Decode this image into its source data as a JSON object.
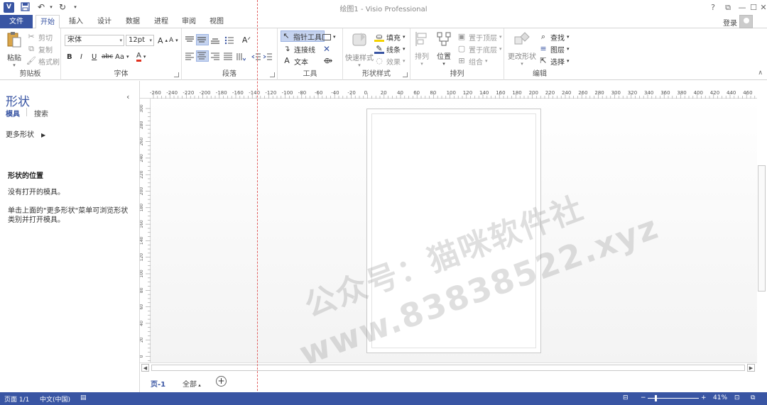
{
  "window": {
    "title": "绘图1 - Visio Professional",
    "app_logo": "V",
    "controls": [
      "?",
      "⧉",
      "—",
      "☐",
      "✕"
    ]
  },
  "qat": {
    "save_icon": "save-icon",
    "undo_icon": "undo-icon",
    "redo_icon": "redo-icon",
    "customize_icon": "customize-icon"
  },
  "tabs": [
    {
      "label": "文件"
    },
    {
      "label": "开始"
    },
    {
      "label": "插入"
    },
    {
      "label": "设计"
    },
    {
      "label": "数据"
    },
    {
      "label": "进程"
    },
    {
      "label": "审阅"
    },
    {
      "label": "视图"
    }
  ],
  "account": {
    "login": "登录"
  },
  "ribbon": {
    "clipboard": {
      "label": "剪贴板",
      "paste": "粘贴",
      "cut": "剪切",
      "copy": "复制",
      "format_painter": "格式刷"
    },
    "font": {
      "label": "字体",
      "font_name": "宋体",
      "font_size": "12pt",
      "bold": "B",
      "italic": "I",
      "underline": "U",
      "strike": "abc",
      "case": "Aa",
      "color": "A",
      "grow": "A",
      "shrink": "A"
    },
    "paragraph": {
      "label": "段落"
    },
    "tools": {
      "label": "工具",
      "pointer": "指针工具",
      "connector": "连接线",
      "text": "文本"
    },
    "shape_styles": {
      "label": "形状样式",
      "quick_styles": "快速样式",
      "fill": "填充",
      "line": "线条",
      "effects": "效果"
    },
    "arrange": {
      "label": "排列",
      "align": "排列",
      "position": "位置",
      "bring_front": "置于顶层",
      "send_back": "置于底层",
      "group": "组合"
    },
    "editing": {
      "label": "编辑",
      "change_shape": "更改形状",
      "find": "查找",
      "layers": "图层",
      "select": "选择"
    }
  },
  "shapes_pane": {
    "title": "形状",
    "tab_stencils": "模具",
    "tab_search": "搜索",
    "more_shapes": "更多形状",
    "heading": "形状的位置",
    "no_stencils": "没有打开的模具。",
    "hint": "单击上面的\"更多形状\"菜单可浏览形状类别并打开模具。"
  },
  "ruler_h": [
    "-260",
    "-240",
    "-220",
    "-200",
    "-180",
    "-160",
    "-140",
    "-120",
    "-100",
    "-80",
    "-60",
    "-40",
    "-20",
    "0",
    "20",
    "40",
    "60",
    "80",
    "100",
    "120",
    "140",
    "160",
    "180",
    "200",
    "220",
    "240",
    "260",
    "280",
    "300",
    "320",
    "340",
    "360",
    "380",
    "400",
    "420",
    "440",
    "460"
  ],
  "ruler_v": [
    "300",
    "280",
    "260",
    "240",
    "220",
    "200",
    "180",
    "160",
    "140",
    "120",
    "100",
    "80",
    "60",
    "40",
    "20",
    "0"
  ],
  "page_tabs": {
    "page1": "页-1",
    "all": "全部",
    "add": "+"
  },
  "status": {
    "page": "页面 1/1",
    "language": "中文(中国)",
    "zoom": "41%"
  },
  "watermark": {
    "line1": "公众号：猫咪软件社",
    "line2": "www.83838522.xyz"
  },
  "colors": {
    "accent": "#3955a3",
    "guide": "#e06060"
  }
}
